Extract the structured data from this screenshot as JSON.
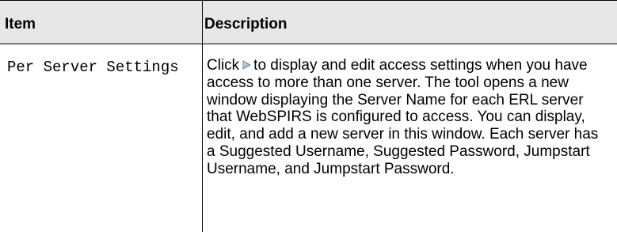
{
  "table": {
    "headers": {
      "item": "Item",
      "description": "Description"
    },
    "rows": [
      {
        "item": "Per Server Settings",
        "description_before_icon": "Click",
        "icon": "play-arrow-icon",
        "description_after_icon": "to display and edit access settings when you have access to more than one server. The tool opens a new window displaying the Server Name for each ERL server that WebSPIRS is configured to access. You can display, edit, and add a new server in this window. Each server has a Suggested Username, Suggested Password, Jumpstart Username, and Jumpstart Password."
      }
    ]
  },
  "colors": {
    "header_background": "#e7e7e7",
    "rule": "#000000"
  }
}
